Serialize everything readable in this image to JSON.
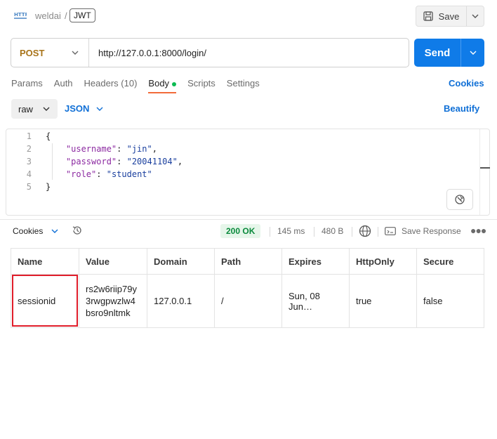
{
  "breadcrumb": {
    "icon_label": "HTTP",
    "workspace": "weldai",
    "separator": "/",
    "request_name": "JWT"
  },
  "save": {
    "label": "Save"
  },
  "request": {
    "method": "POST",
    "url": "http://127.0.0.1:8000/login/",
    "send_label": "Send"
  },
  "tabs": [
    {
      "label": "Params"
    },
    {
      "label": "Auth"
    },
    {
      "label": "Headers (10)"
    },
    {
      "label": "Body"
    },
    {
      "label": "Scripts"
    },
    {
      "label": "Settings"
    }
  ],
  "cookies_link": "Cookies",
  "body_mode": {
    "raw": "raw",
    "format": "JSON",
    "beautify": "Beautify"
  },
  "editor": {
    "lines": [
      {
        "n": "1",
        "text": "{"
      },
      {
        "n": "2",
        "key": "\"username\"",
        "value": "\"jin\"",
        "trail": ","
      },
      {
        "n": "3",
        "key": "\"password\"",
        "value": "\"20041104\"",
        "trail": ","
      },
      {
        "n": "4",
        "key": "\"role\"",
        "value": "\"student\"",
        "trail": ""
      },
      {
        "n": "5",
        "text": "}"
      }
    ]
  },
  "response": {
    "tab": "Cookies",
    "status": "200 OK",
    "time": "145 ms",
    "size": "480 B",
    "save_response": "Save Response",
    "status_color": "#0a8a3c"
  },
  "cookies_table": {
    "headers": [
      "Name",
      "Value",
      "Domain",
      "Path",
      "Expires",
      "HttpOnly",
      "Secure"
    ],
    "rows": [
      [
        "sessionid",
        "rs2w6riip79y3rwgpwzlw4bsro9nltmk",
        "127.0.0.1",
        "/",
        "Sun, 08 Jun…",
        "true",
        "false"
      ]
    ]
  },
  "colors": {
    "accent": "#0f7be8",
    "highlight": "#e01d2a",
    "tab_underline": "#f26b3a"
  }
}
